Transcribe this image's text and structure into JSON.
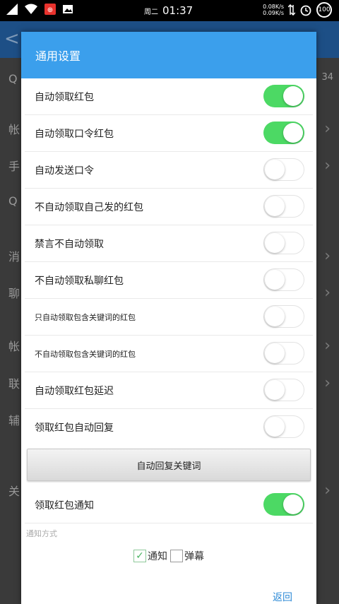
{
  "status_bar": {
    "day": "周二",
    "time": "01:37",
    "speed_up": "0.08K/s",
    "speed_down": "0.09K/s",
    "battery": "100"
  },
  "background": {
    "side_chars": [
      "Q",
      "帐",
      "手",
      "Q",
      "消",
      "聊",
      "帐",
      "联",
      "辅",
      "关"
    ],
    "number_hint": "34"
  },
  "dialog": {
    "title": "通用设置",
    "settings": [
      {
        "label": "自动领取红包",
        "enabled": true,
        "small": false
      },
      {
        "label": "自动领取口令红包",
        "enabled": true,
        "small": false
      },
      {
        "label": "自动发送口令",
        "enabled": false,
        "small": false
      },
      {
        "label": "不自动领取自己发的红包",
        "enabled": false,
        "small": false
      },
      {
        "label": "禁言不自动领取",
        "enabled": false,
        "small": false
      },
      {
        "label": "不自动领取私聊红包",
        "enabled": false,
        "small": false
      },
      {
        "label": "只自动领取包含关键词的红包",
        "enabled": false,
        "small": true
      },
      {
        "label": "不自动领取包含关键词的红包",
        "enabled": false,
        "small": true
      },
      {
        "label": "自动领取红包延迟",
        "enabled": false,
        "small": false
      },
      {
        "label": "领取红包自动回复",
        "enabled": false,
        "small": false
      }
    ],
    "keyword_button": "自动回复关键词",
    "notify": {
      "label": "领取红包通知",
      "enabled": true
    },
    "notify_method_label": "通知方式",
    "method_options": [
      {
        "label": "通知",
        "checked": true
      },
      {
        "label": "弹幕",
        "checked": false
      }
    ],
    "back_button": "返回"
  },
  "colors": {
    "header": "#3b9fec",
    "toggle_on": "#4cd964",
    "link": "#2d8ad6"
  }
}
